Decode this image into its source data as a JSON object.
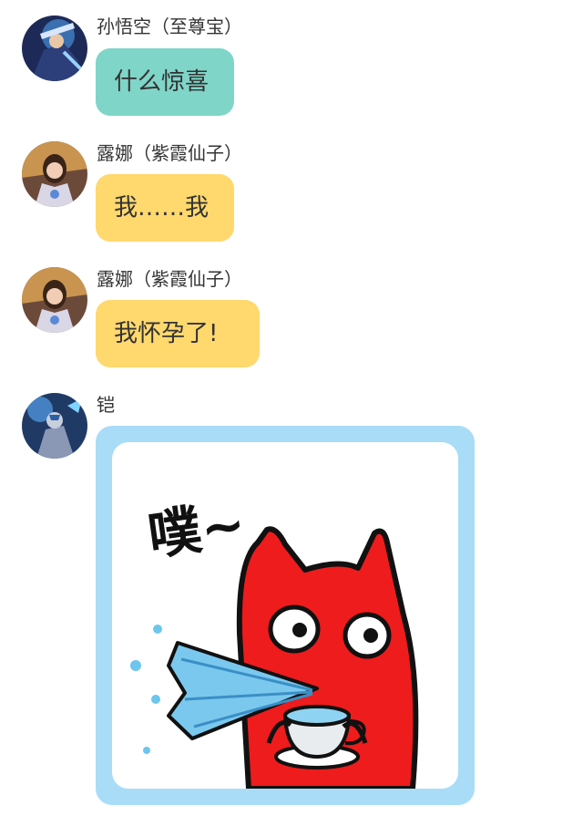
{
  "messages": [
    {
      "sender": "孙悟空（至尊宝）",
      "text": "什么惊喜",
      "bubble_color": "#7fd5c8",
      "avatar": "avatar-wukong"
    },
    {
      "sender": "露娜（紫霞仙子）",
      "text": "我……我",
      "bubble_color": "#ffd86e",
      "avatar": "avatar-luna"
    },
    {
      "sender": "露娜（紫霞仙子）",
      "text": "我怀孕了!",
      "bubble_color": "#ffd86e",
      "avatar": "avatar-luna"
    },
    {
      "sender": "铠",
      "sticker_text": "噗~",
      "sticker_icon": "red-cat-spitting-tea-sticker",
      "avatar": "avatar-kai"
    }
  ],
  "colors": {
    "teal_bubble": "#7fd5c8",
    "yellow_bubble": "#ffd86e",
    "sticker_border": "#a9dcf7",
    "sticker_cat": "#ee1c1c"
  }
}
